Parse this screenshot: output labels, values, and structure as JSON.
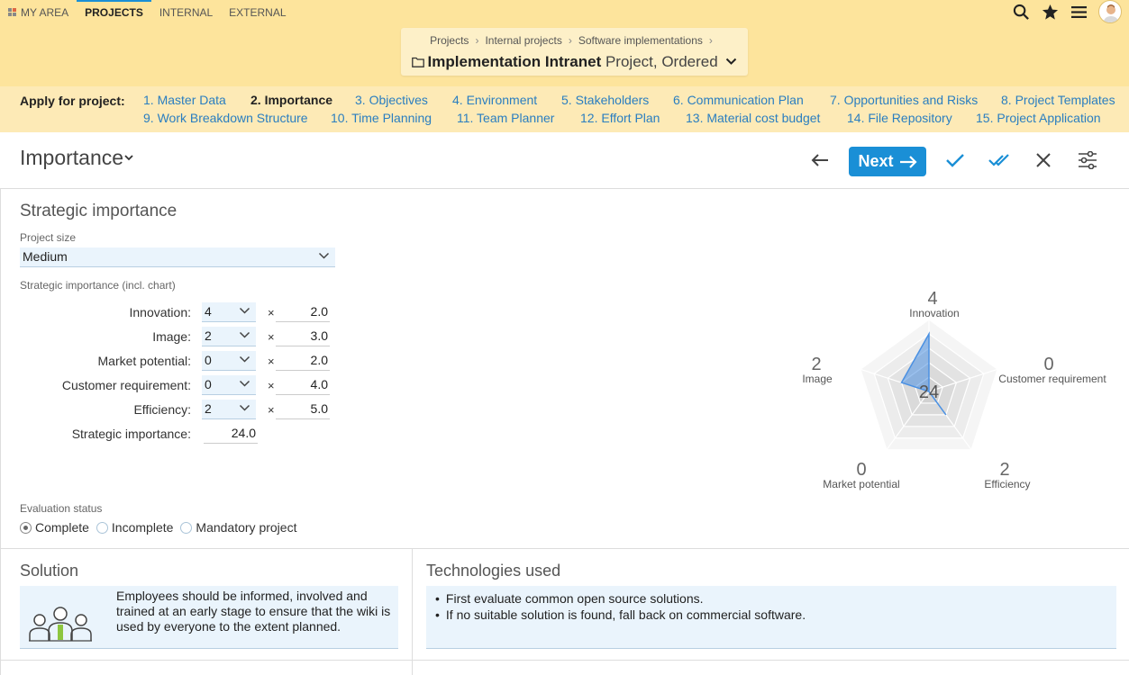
{
  "topnav": {
    "tabs": [
      {
        "label": "MY AREA",
        "active": false
      },
      {
        "label": "PROJECTS",
        "active": true
      },
      {
        "label": "INTERNAL",
        "active": false
      },
      {
        "label": "EXTERNAL",
        "active": false
      }
    ],
    "icons": [
      "search-icon",
      "star-icon",
      "menu-icon",
      "user-avatar"
    ]
  },
  "breadcrumb": {
    "items": [
      "Projects",
      "Internal projects",
      "Software implementations"
    ],
    "object_title": "Implementation Intranet",
    "object_subtitle": "Project, Ordered"
  },
  "steps": {
    "label": "Apply for project:",
    "items": [
      "1. Master Data",
      "2. Importance",
      "3. Objectives",
      "4. Environment",
      "5. Stakeholders",
      "6. Communication Plan",
      "7. Opportunities and Risks",
      "8. Project Templates",
      "9. Work Breakdown Structure",
      "10. Time Planning",
      "11. Team Planner",
      "12. Effort Plan",
      "13. Material cost budget",
      "14. File Repository",
      "15. Project Application"
    ],
    "current": "2. Importance"
  },
  "page": {
    "title": "Importance",
    "next_label": "Next"
  },
  "strategic": {
    "section_title": "Strategic importance",
    "project_size_label": "Project size",
    "project_size_value": "Medium",
    "importance_label": "Strategic importance (incl. chart)",
    "rows": [
      {
        "label": "Innovation:",
        "value": "4",
        "times": "×",
        "weight": "2.0"
      },
      {
        "label": "Image:",
        "value": "2",
        "times": "×",
        "weight": "3.0"
      },
      {
        "label": "Market potential:",
        "value": "0",
        "times": "×",
        "weight": "2.0"
      },
      {
        "label": "Customer requirement:",
        "value": "0",
        "times": "×",
        "weight": "4.0"
      },
      {
        "label": "Efficiency:",
        "value": "2",
        "times": "×",
        "weight": "5.0"
      }
    ],
    "total_label": "Strategic importance:",
    "total_value": "24.0",
    "eval_label": "Evaluation status",
    "eval_options": [
      {
        "label": "Complete",
        "selected": true
      },
      {
        "label": "Incomplete",
        "selected": false
      },
      {
        "label": "Mandatory project",
        "selected": false
      }
    ]
  },
  "chart_data": {
    "type": "radar",
    "axes": [
      "Innovation",
      "Customer requirement",
      "Efficiency",
      "Market potential",
      "Image"
    ],
    "values": [
      4,
      0,
      2,
      0,
      2
    ],
    "max": 5,
    "center_label": "24",
    "fill_color": "#4a90e2"
  },
  "solution": {
    "title": "Solution",
    "text": "Employees should be informed, involved and trained at an early stage to ensure that the wiki is used by everyone to the extent planned."
  },
  "technologies": {
    "title": "Technologies used",
    "items": [
      "First evaluate common open source solutions.",
      "If no suitable solution is found, fall back on commercial software."
    ]
  }
}
